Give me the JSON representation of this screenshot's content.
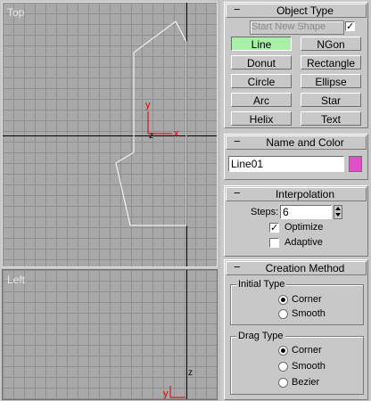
{
  "viewports": {
    "top": {
      "label": "Top"
    },
    "left": {
      "label": "Left"
    }
  },
  "axis": {
    "x": "x",
    "y": "y",
    "z": "z"
  },
  "object_type": {
    "title": "Object Type",
    "start_new_shape": "Start New Shape",
    "start_new_shape_checked": true,
    "buttons": [
      "Line",
      "NGon",
      "Donut",
      "Rectangle",
      "Circle",
      "Ellipse",
      "Arc",
      "Star",
      "Helix",
      "Text"
    ],
    "active_button": "Line"
  },
  "name_and_color": {
    "title": "Name and Color",
    "name": "Line01",
    "color": "#e050c8"
  },
  "interpolation": {
    "title": "Interpolation",
    "steps_label": "Steps:",
    "steps_value": "6",
    "optimize_label": "Optimize",
    "optimize_checked": true,
    "adaptive_label": "Adaptive",
    "adaptive_checked": false
  },
  "creation_method": {
    "title": "Creation Method",
    "initial_type": {
      "title": "Initial Type",
      "options": [
        "Corner",
        "Smooth"
      ],
      "selected": "Corner"
    },
    "drag_type": {
      "title": "Drag Type",
      "options": [
        "Corner",
        "Smooth",
        "Bezier"
      ],
      "selected": "Corner"
    }
  }
}
